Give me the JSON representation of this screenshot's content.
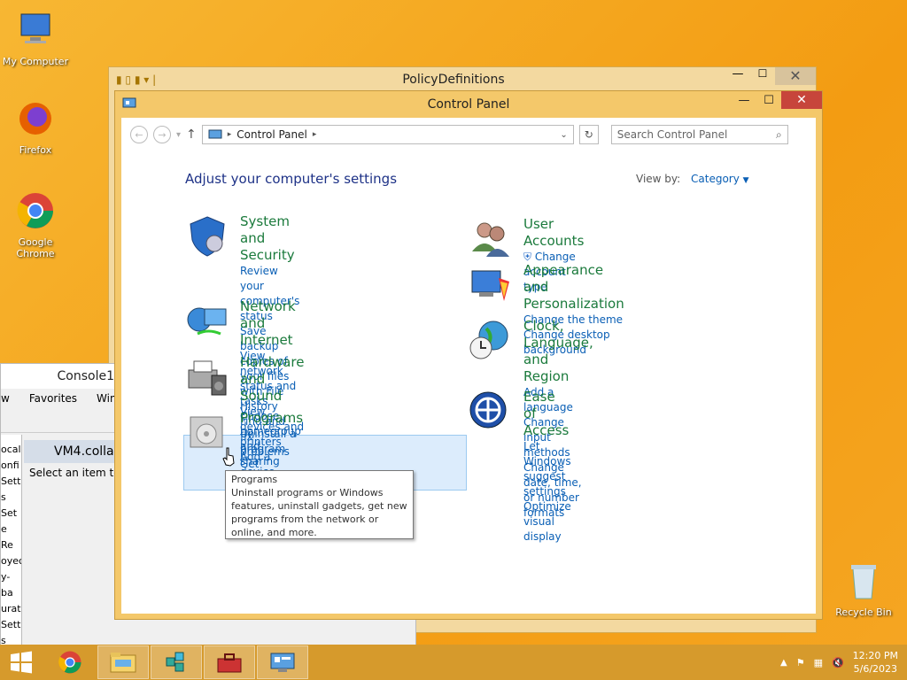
{
  "desktop": {
    "icons": [
      {
        "label": "My Computer"
      },
      {
        "label": "Firefox"
      },
      {
        "label": "Google Chrome"
      },
      {
        "label": "Recycle Bin"
      }
    ]
  },
  "bg_windows": {
    "policy_title": "PolicyDefinitions",
    "console_title": "Console1",
    "console_menu": [
      "w",
      "Favorites",
      "Window"
    ],
    "console_node": "VM4.colla",
    "console_hint": "Select an item to v",
    "console_tree": [
      "ocal",
      "onfi",
      "Sett",
      "s Set",
      "e Re",
      "oyec",
      "y-ba",
      "urati",
      "Sett",
      "s Set"
    ]
  },
  "window": {
    "title": "Control Panel",
    "minimize": "—",
    "maximize": "☐",
    "close": "✕"
  },
  "address": {
    "crumb": "Control Panel",
    "search_placeholder": "Search Control Panel"
  },
  "main": {
    "heading": "Adjust your computer's settings",
    "view_by_label": "View by:",
    "view_by_value": "Category"
  },
  "categories_left": [
    {
      "title": "System and Security",
      "links": [
        "Review your computer's status",
        "Save backup copies of your files with File",
        "History",
        "Find and fix problems"
      ]
    },
    {
      "title": "Network and Internet",
      "links": [
        "View network status and tasks",
        "Choose homegroup and sharing options"
      ]
    },
    {
      "title": "Hardware and Sound",
      "links": [
        "View devices and printers",
        "Add a device"
      ]
    },
    {
      "title": "Programs",
      "links": [
        "Uninstall a program",
        "Get programs"
      ]
    }
  ],
  "categories_right": [
    {
      "title": "User Accounts",
      "links": [
        "Change account type"
      ]
    },
    {
      "title": "Appearance and Personalization",
      "links": [
        "Change the theme",
        "Change desktop background"
      ]
    },
    {
      "title": "Clock, Language, and Region",
      "links": [
        "Add a language",
        "Change input methods",
        "Change date, time, or number formats"
      ]
    },
    {
      "title": "Ease of Access",
      "links": [
        "Let Windows suggest settings",
        "Optimize visual display"
      ]
    }
  ],
  "tooltip": {
    "title": "Programs",
    "body": "Uninstall programs or Windows features, uninstall gadgets, get new programs from the network or online, and more."
  },
  "taskbar": {
    "time": "12:20 PM",
    "date": "5/6/2023"
  }
}
